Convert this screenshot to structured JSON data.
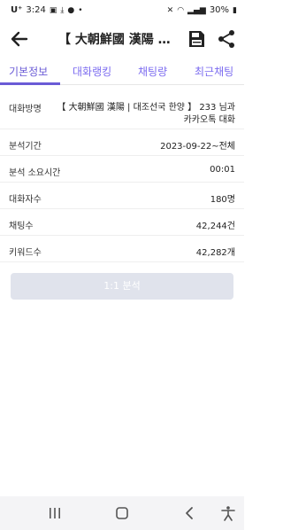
{
  "status_bar": {
    "time": "3:24",
    "carrier": "U⁺",
    "battery": "30%"
  },
  "app_bar": {
    "title": "【 大朝鮮國 漢陽 | 대조선국 한양 】 233 님과 카카오톡 대화"
  },
  "tabs": [
    {
      "label": "기본정보",
      "active": true
    },
    {
      "label": "대화랭킹",
      "active": false
    },
    {
      "label": "채팅량",
      "active": false
    },
    {
      "label": "최근채팅",
      "active": false
    }
  ],
  "info": {
    "room_label": "대화방명",
    "room_value_line1": "【 大朝鮮國 漢陽 | 대조선국 한양 】 233 님과",
    "room_value_line2": "카카오톡 대화",
    "period_label": "분석기간",
    "period_value": "2023-09-22~전체",
    "duration_label": "분석 소요시간",
    "duration_value": "00:01",
    "members_label": "대화자수",
    "members_value": "180명",
    "chats_label": "채팅수",
    "chats_value": "42,244건",
    "keywords_label": "키워드수",
    "keywords_value": "42,282개"
  },
  "analyze_button": {
    "label": "1:1 분석",
    "enabled": false
  },
  "colors": {
    "accent": "#6a5bd6",
    "tab_text": "#7c6cf0",
    "disabled_button": "#e0e3ec"
  }
}
